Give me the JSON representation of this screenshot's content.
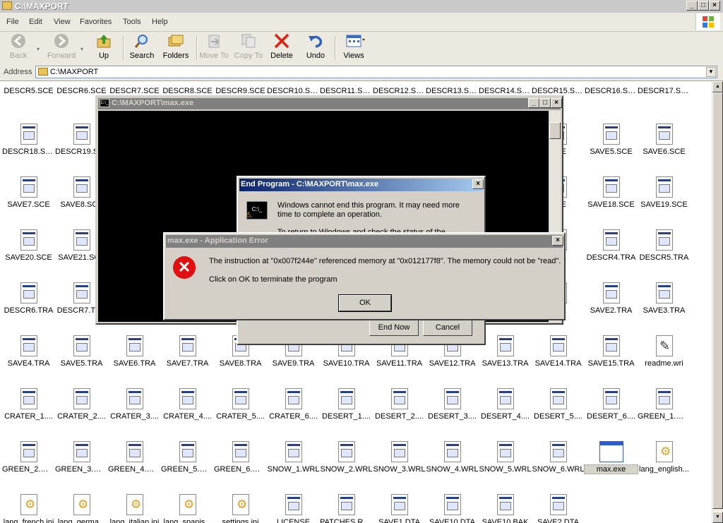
{
  "window": {
    "title": "C:\\MAXPORT",
    "min": "_",
    "max": "□",
    "close": "×"
  },
  "menu": [
    "File",
    "Edit",
    "View",
    "Favorites",
    "Tools",
    "Help"
  ],
  "toolbar": {
    "back": "Back",
    "forward": "Forward",
    "up": "Up",
    "search": "Search",
    "folders": "Folders",
    "moveto": "Move To",
    "copyto": "Copy To",
    "delete": "Delete",
    "undo": "Undo",
    "views": "Views"
  },
  "address": {
    "label": "Address",
    "value": "C:\\MAXPORT"
  },
  "files": [
    [
      "DESCR5.SCE",
      "DESCR6.SCE",
      "DESCR7.SCE",
      "DESCR8.SCE",
      "DESCR9.SCE",
      "DESCR10.SCE",
      "DESCR11.SCE",
      "DESCR12.SCE",
      "DESCR13.SCE",
      "DESCR14.SCE",
      "DESCR15.SCE",
      "DESCR16.SCE",
      "DESCR17.SCE"
    ],
    [
      "DESCR18.SCE",
      "DESCR19.SCE",
      "",
      "",
      "",
      "",
      "",
      "",
      "",
      "",
      "SCE",
      "SAVE5.SCE",
      "SAVE6.SCE"
    ],
    [
      "SAVE7.SCE",
      "SAVE8.SCE",
      "",
      "",
      "",
      "",
      "",
      "",
      "",
      "",
      "SCE",
      "SAVE18.SCE",
      "SAVE19.SCE"
    ],
    [
      "SAVE20.SCE",
      "SAVE21.SCE",
      "",
      "",
      "",
      "",
      "",
      "",
      "",
      "",
      "TRA",
      "DESCR4.TRA",
      "DESCR5.TRA"
    ],
    [
      "DESCR6.TRA",
      "DESCR7.TRA",
      "",
      "",
      "",
      "",
      "",
      "",
      "",
      "",
      "TRA",
      "SAVE2.TRA",
      "SAVE3.TRA"
    ],
    [
      "SAVE4.TRA",
      "SAVE5.TRA",
      "SAVE6.TRA",
      "SAVE7.TRA",
      "SAVE8.TRA",
      "SAVE9.TRA",
      "SAVE10.TRA",
      "SAVE11.TRA",
      "SAVE12.TRA",
      "SAVE13.TRA",
      "SAVE14.TRA",
      "SAVE15.TRA",
      "readme.wri"
    ],
    [
      "CRATER_1....",
      "CRATER_2....",
      "CRATER_3....",
      "CRATER_4....",
      "CRATER_5....",
      "CRATER_6....",
      "DESERT_1....",
      "DESERT_2....",
      "DESERT_3....",
      "DESERT_4....",
      "DESERT_5....",
      "DESERT_6....",
      "GREEN_1.WRL"
    ],
    [
      "GREEN_2.WRL",
      "GREEN_3.WRL",
      "GREEN_4.WRL",
      "GREEN_5.WRL",
      "GREEN_6.WRL",
      "SNOW_1.WRL",
      "SNOW_2.WRL",
      "SNOW_3.WRL",
      "SNOW_4.WRL",
      "SNOW_5.WRL",
      "SNOW_6.WRL",
      "max.exe",
      "lang_english..."
    ],
    [
      "lang_french.ini",
      "lang_germa...",
      "lang_italian.ini",
      "lang_spanis...",
      "settings.ini",
      "LICENSE",
      "PATCHES.RES",
      "SAVE1.DTA",
      "SAVE10.DTA",
      "SAVE10.BAK",
      "SAVE2.DTA",
      "",
      ""
    ]
  ],
  "console": {
    "title": "C:\\MAXPORT\\max.exe",
    "icon_text": "C:\\_"
  },
  "end_program": {
    "title": "End Program - C:\\MAXPORT\\max.exe",
    "message": "Windows cannot end this program. It may need more time to complete an operation.",
    "message2": "To return to Windows and check the status of the",
    "end_now": "End Now",
    "cancel": "Cancel",
    "close": "×",
    "icon_text": "C:\\_"
  },
  "app_error": {
    "title": "max.exe - Application Error",
    "message": "The instruction at \"0x007f244e\" referenced memory at \"0x012177f8\". The memory could not be \"read\".",
    "message2": "Click on OK to terminate the program",
    "ok": "OK",
    "close": "×",
    "icon": "✕"
  }
}
